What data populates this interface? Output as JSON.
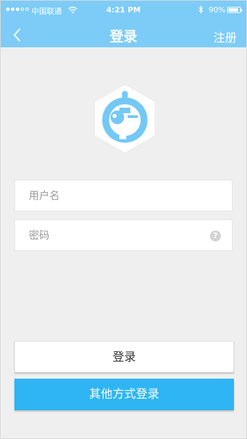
{
  "status_bar": {
    "carrier": "中国联通",
    "time": "4:21 PM",
    "battery_percent": "90%",
    "battery_level": 0.9,
    "signal_bars_filled": 3,
    "signal_bars_total": 5
  },
  "nav": {
    "back_icon": "chevron-left-icon",
    "title": "登录",
    "register_label": "注册"
  },
  "form": {
    "username_placeholder": "用户名",
    "password_placeholder": "密码",
    "help_glyph": "?"
  },
  "buttons": {
    "login_label": "登录",
    "other_login_label": "其他方式登录"
  },
  "colors": {
    "header": "#7dccf7",
    "logo_blue": "#74c8f5",
    "primary_button": "#2fb5f3",
    "background": "#efefef"
  }
}
